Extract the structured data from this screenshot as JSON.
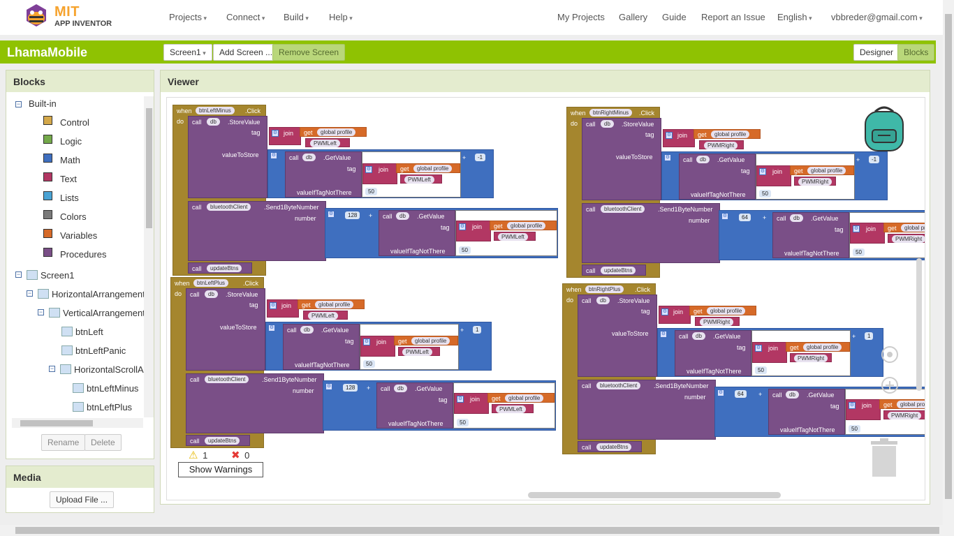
{
  "nav": {
    "logo_mit": "MIT",
    "logo_sub": "APP INVENTOR",
    "menus": [
      "Projects",
      "Connect",
      "Build",
      "Help"
    ],
    "links": [
      "My Projects",
      "Gallery",
      "Guide",
      "Report an Issue"
    ],
    "language": "English",
    "account": "vbbreder@gmail.com"
  },
  "project": {
    "title": "LhamaMobile",
    "screen_select": "Screen1",
    "add_screen": "Add Screen ...",
    "remove_screen": "Remove Screen",
    "designer": "Designer",
    "blocks": "Blocks"
  },
  "blocks_panel": {
    "title": "Blocks",
    "builtin": "Built-in",
    "builtin_items": [
      {
        "label": "Control",
        "color": "#d4a84a"
      },
      {
        "label": "Logic",
        "color": "#74a94a"
      },
      {
        "label": "Math",
        "color": "#3f6fbf"
      },
      {
        "label": "Text",
        "color": "#b23763"
      },
      {
        "label": "Lists",
        "color": "#4aa3d4"
      },
      {
        "label": "Colors",
        "color": "#7a7a7a"
      },
      {
        "label": "Variables",
        "color": "#d66a28"
      },
      {
        "label": "Procedures",
        "color": "#7a4f87"
      }
    ],
    "components": [
      "Screen1",
      "HorizontalArrangement",
      "VerticalArrangement",
      "btnLeft",
      "btnLeftPanic",
      "HorizontalScrollArrangement",
      "btnLeftMinus",
      "btnLeftPlus"
    ],
    "rename": "Rename",
    "delete": "Delete"
  },
  "media_panel": {
    "title": "Media",
    "upload": "Upload File ..."
  },
  "viewer": {
    "title": "Viewer",
    "warnings_count": "1",
    "errors_count": "0",
    "show_warnings": "Show Warnings"
  },
  "code": {
    "when": "when",
    "do": "do",
    "call": "call",
    "get": "get",
    "join": "join",
    "click": ".Click",
    "db": "db",
    "store_value": ".StoreValue",
    "get_value": ".GetValue",
    "tag": "tag",
    "value_to_store": "valueToStore",
    "value_if_tag_not_there": "valueIfTagNotThere",
    "bt": "bluetoothClient",
    "send": ".Send1ByteNumber",
    "number": "number",
    "update": "updateBtns",
    "global_profile": "global profile",
    "plus": "+",
    "events": [
      {
        "button": "btnLeftMinus",
        "key": "PWMLeft",
        "delta": "-1",
        "base": "128",
        "fallback": "50"
      },
      {
        "button": "btnRightMinus",
        "key": "PWMRight",
        "delta": "-1",
        "base": "64",
        "fallback": "50"
      },
      {
        "button": "btnLeftPlus",
        "key": "PWMLeft",
        "delta": "1",
        "base": "128",
        "fallback": "50"
      },
      {
        "button": "btnRightPlus",
        "key": "PWMRight",
        "delta": "1",
        "base": "64",
        "fallback": "50"
      }
    ]
  }
}
